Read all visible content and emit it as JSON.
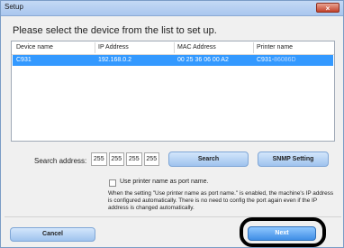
{
  "window": {
    "title": "Setup",
    "close_icon": "×"
  },
  "instruction": "Please select the device from the list to set up.",
  "device_list": {
    "columns": [
      "Device name",
      "IP Address",
      "MAC Address",
      "Printer name"
    ],
    "rows": [
      {
        "device_name": "C931",
        "ip": "192.168.0.2",
        "mac": "00 25 36 06 00 A2",
        "printer_name": "C931-",
        "printer_suffix": "86086D"
      }
    ]
  },
  "search": {
    "label": "Search address:",
    "octets": [
      "255",
      "255",
      "255",
      "255"
    ],
    "search_button": "Search",
    "snmp_button": "SNMP Setting"
  },
  "use_printer_name": {
    "checkbox_label": "Use printer name as port name.",
    "note": "When the setting \"Use printer name as port name.\" is enabled, the machine's IP address is configured automatically. There is no need to config the port again even if the IP address is changed automatically."
  },
  "footer": {
    "cancel_button": "Cancel",
    "next_button": "Next"
  }
}
